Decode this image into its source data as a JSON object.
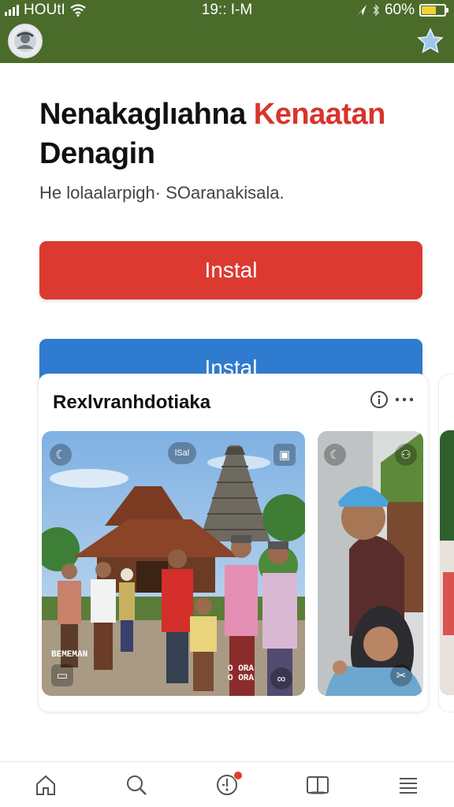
{
  "status_bar": {
    "carrier": "HOUtI",
    "time": "19:: I-M",
    "battery": "60%",
    "battery_level": 0.6
  },
  "header": {
    "avatar_icon": "avatar-icon",
    "favorite_icon": "star-icon"
  },
  "hero": {
    "title_main": "Nenakaglıahna",
    "title_accent": "Kenaatan",
    "title_line2": "Denagin",
    "subtitle": "He lolaalarpigh· SOaranakisala."
  },
  "buttons": {
    "primary_label": "Instal",
    "secondary_label": "Instal"
  },
  "feed_card": {
    "title": "Rexlvranhdotiaka",
    "photo1_top_label": "lSal",
    "photo1_bottom_left_label": "BEMEMAN",
    "photo1_bottom_right_label": "O ORA\nO ORA"
  },
  "bottom_nav": {
    "items": [
      "home-icon",
      "search-icon",
      "notifications-icon",
      "book-icon",
      "menu-icon"
    ]
  },
  "colors": {
    "header_green": "#4b6b2b",
    "accent_red": "#dc3a31",
    "accent_blue": "#2f7bcf",
    "badge_red": "#e23b2f"
  }
}
